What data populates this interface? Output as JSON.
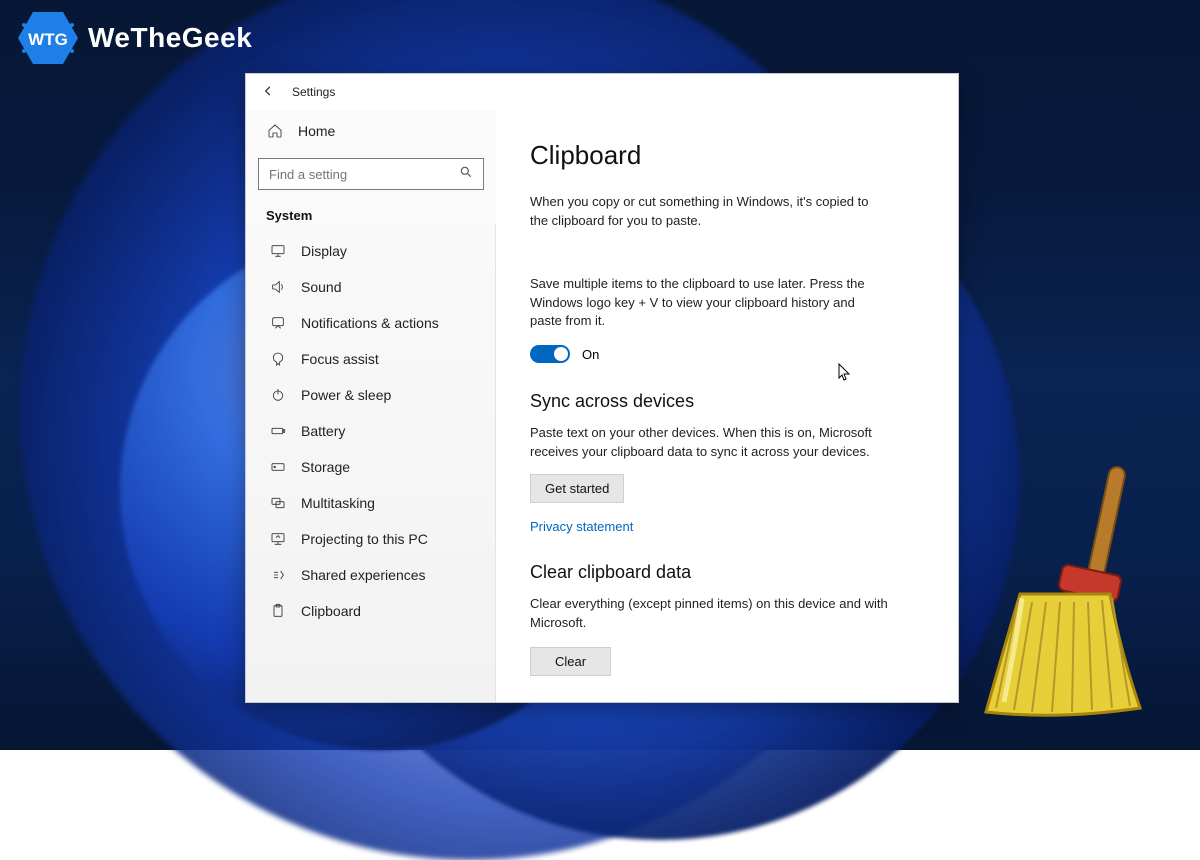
{
  "branding": {
    "text": "WeTheGeek",
    "badge_letters": "WTG"
  },
  "window": {
    "title": "Settings",
    "back_aria": "Back"
  },
  "sidebar": {
    "home_label": "Home",
    "search_placeholder": "Find a setting",
    "section_label": "System",
    "items": [
      {
        "label": "Display"
      },
      {
        "label": "Sound"
      },
      {
        "label": "Notifications & actions"
      },
      {
        "label": "Focus assist"
      },
      {
        "label": "Power & sleep"
      },
      {
        "label": "Battery"
      },
      {
        "label": "Storage"
      },
      {
        "label": "Multitasking"
      },
      {
        "label": "Projecting to this PC"
      },
      {
        "label": "Shared experiences"
      },
      {
        "label": "Clipboard"
      }
    ]
  },
  "content": {
    "title": "Clipboard",
    "intro": "When you copy or cut something in Windows, it's copied to the clipboard for you to paste.",
    "history_desc": "Save multiple items to the clipboard to use later. Press the Windows logo key + V to view your clipboard history and paste from it.",
    "history_toggle_state": "On",
    "sync_heading": "Sync across devices",
    "sync_desc": "Paste text on your other devices. When this is on, Microsoft receives your clipboard data to sync it across your devices.",
    "sync_button": "Get started",
    "privacy_link": "Privacy statement",
    "clear_heading": "Clear clipboard data",
    "clear_desc": "Clear everything (except pinned items) on this device and with Microsoft.",
    "clear_button": "Clear"
  },
  "colors": {
    "accent": "#0067c0"
  }
}
